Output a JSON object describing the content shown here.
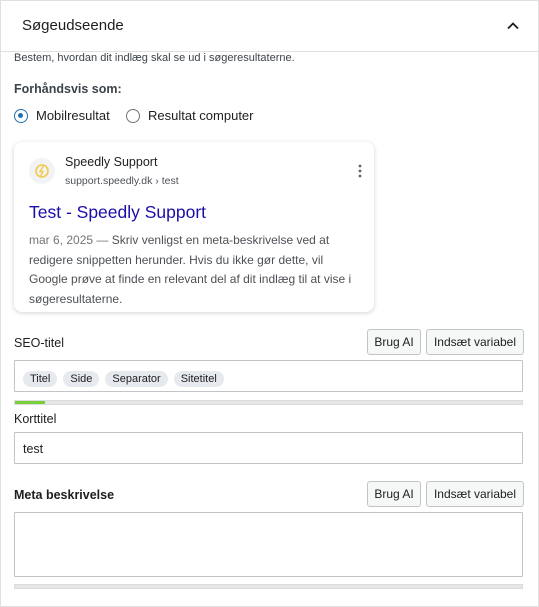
{
  "panel": {
    "title": "Søgeudseende",
    "intro": "Bestem, hvordan dit indlæg skal se ud i søgeresultaterne."
  },
  "preview": {
    "label": "Forhåndsvis som:",
    "options": [
      {
        "label": "Mobilresultat",
        "checked": true
      },
      {
        "label": "Resultat computer",
        "checked": false
      }
    ]
  },
  "snippet": {
    "site_name": "Speedly Support",
    "url": "support.speedly.dk › test",
    "title": "Test - Speedly Support",
    "date": "mar 6, 2025",
    "separator": "—",
    "description": "Skriv venligst en meta-beskrivelse ved at redigere snippetten herunder. Hvis du ikke gør dette, vil Google prøve at finde en relevant del af dit indlæg til at vise i søgeresultaterne."
  },
  "seo_title": {
    "label": "SEO-titel",
    "ai_button": "Brug AI",
    "variable_button": "Indsæt variabel",
    "tags": [
      "Titel",
      "Side",
      "Separator",
      "Sitetitel"
    ],
    "progress": 0.06
  },
  "slug": {
    "label": "Korttitel",
    "value": "test"
  },
  "meta": {
    "label": "Meta beskrivelse",
    "ai_button": "Brug AI",
    "variable_button": "Indsæt variabel",
    "value": "",
    "progress": 0
  },
  "colors": {
    "accent": "#2271b1",
    "link": "#1a0dab",
    "progress_good": "#7ad03a",
    "favicon": "#f2c94c"
  }
}
